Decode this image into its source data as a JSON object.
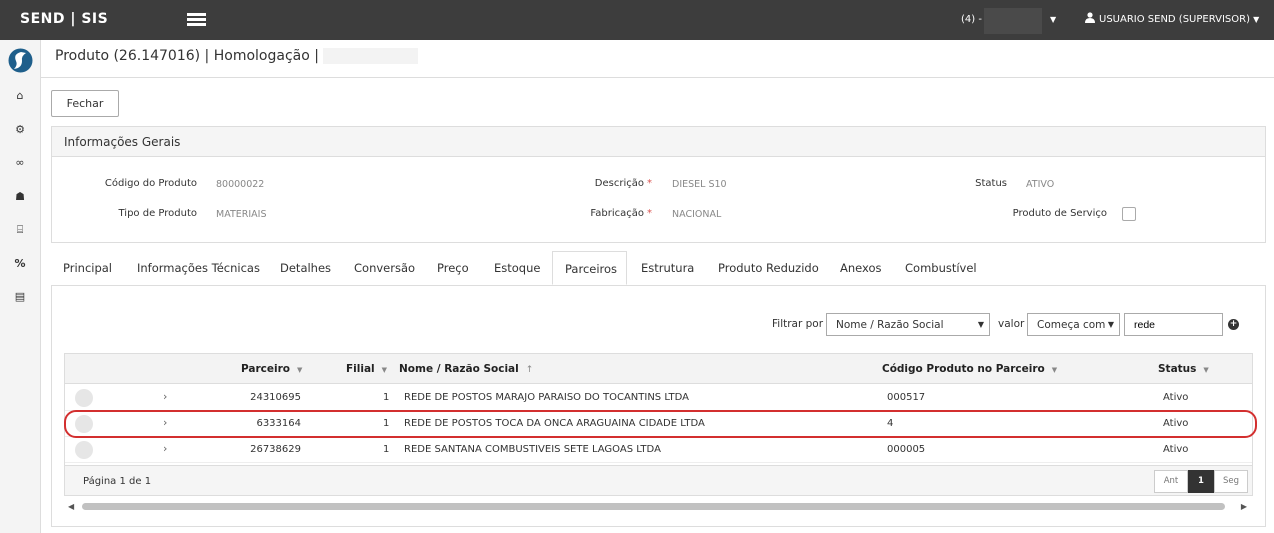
{
  "app": {
    "title": "SEND | SIS"
  },
  "topbar": {
    "company_label": "(4) -",
    "user_name": "USUARIO SEND (SUPERVISOR)"
  },
  "sidebar": {
    "icons": [
      "home-icon",
      "cogs-icon",
      "handshake-icon",
      "cubes-icon",
      "bank-icon",
      "percent-icon",
      "print-icon"
    ]
  },
  "breadcrumb": {
    "text": "Produto (26.147016) | Homologação |"
  },
  "actions": {
    "close_label": "Fechar"
  },
  "info": {
    "title": "Informações Gerais",
    "codigo_label": "Código do Produto",
    "codigo_value": "80000022",
    "tipo_label": "Tipo de Produto",
    "tipo_value": "MATERIAIS",
    "descricao_label": "Descrição",
    "descricao_value": "DIESEL S10",
    "fabricacao_label": "Fabricação",
    "fabricacao_value": "NACIONAL",
    "status_label": "Status",
    "status_value": "ATIVO",
    "servico_label": "Produto de Serviço",
    "required_mark": "*"
  },
  "tabs": [
    "Principal",
    "Informações Técnicas",
    "Detalhes",
    "Conversão",
    "Preço",
    "Estoque",
    "Parceiros",
    "Estrutura",
    "Produto Reduzido",
    "Anexos",
    "Combustível"
  ],
  "active_tab": "Parceiros",
  "filter": {
    "label": "Filtrar por",
    "field": "Nome / Razão Social",
    "valor_label": "valor",
    "operator": "Começa com",
    "value": "rede"
  },
  "grid": {
    "columns": {
      "parceiro": "Parceiro",
      "filial": "Filial",
      "nome": "Nome / Razão Social",
      "codigo": "Código Produto no Parceiro",
      "status": "Status"
    },
    "rows": [
      {
        "parceiro": "24310695",
        "filial": "1",
        "nome": "REDE DE POSTOS MARAJO PARAISO DO TOCANTINS LTDA",
        "codigo": "000517",
        "status": "Ativo"
      },
      {
        "parceiro": "6333164",
        "filial": "1",
        "nome": "REDE DE POSTOS TOCA DA ONCA ARAGUAINA CIDADE LTDA",
        "codigo": "4",
        "status": "Ativo"
      },
      {
        "parceiro": "26738629",
        "filial": "1",
        "nome": "REDE SANTANA COMBUSTIVEIS SETE LAGOAS LTDA",
        "codigo": "000005",
        "status": "Ativo"
      }
    ],
    "highlighted_row": 1,
    "page_info": "Página 1 de 1",
    "pager": {
      "prev": "Ant",
      "current": "1",
      "next": "Seg"
    }
  }
}
